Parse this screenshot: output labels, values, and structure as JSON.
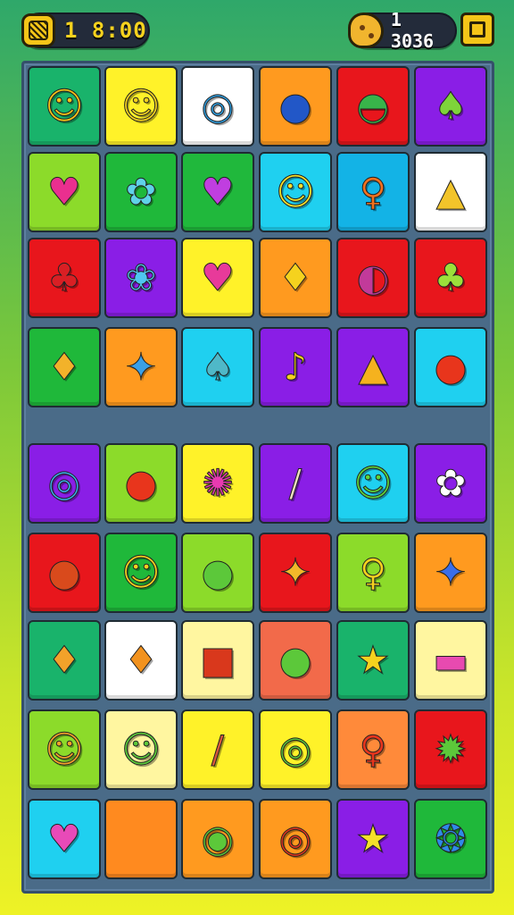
{
  "hud": {
    "coins": "1 8:00",
    "score": "1 3036",
    "coin_icon": "coin-icon",
    "cookie_icon": "cookie-icon",
    "menu_icon": "menu-icon"
  },
  "board": {
    "rows": [
      [
        {
          "name": "lion-face",
          "glyph": "☺",
          "bg": "#19b36b",
          "fg": "#f5c518"
        },
        {
          "name": "sun-face",
          "glyph": "☺",
          "bg": "#fff229",
          "fg": "#f5d21e"
        },
        {
          "name": "swirl-candy",
          "glyph": "◎",
          "bg": "#ffffff",
          "fg": "#2e9ee0"
        },
        {
          "name": "blue-ball",
          "glyph": "●",
          "bg": "#ff9a1f",
          "fg": "#2257c7"
        },
        {
          "name": "watermelon-ball",
          "glyph": "◓",
          "bg": "#e8161c",
          "fg": "#38b54a"
        },
        {
          "name": "green-leaf",
          "glyph": "♠",
          "bg": "#8a1ee6",
          "fg": "#7ed43a"
        }
      ],
      [
        {
          "name": "pink-cat",
          "glyph": "♥",
          "bg": "#8cdb2a",
          "fg": "#ea2f8f"
        },
        {
          "name": "blue-bow",
          "glyph": "✿",
          "bg": "#1fb83a",
          "fg": "#5fd2e8"
        },
        {
          "name": "purple-cat",
          "glyph": "♥",
          "bg": "#20b83c",
          "fg": "#c03ee0"
        },
        {
          "name": "yellow-cat",
          "glyph": "☺",
          "bg": "#1fd0f0",
          "fg": "#f5e12a"
        },
        {
          "name": "orange-lollipop",
          "glyph": "♀",
          "bg": "#13b3e6",
          "fg": "#f2711e"
        },
        {
          "name": "ice-cream-cone",
          "glyph": "▲",
          "bg": "#ffffff",
          "fg": "#f2c42a"
        }
      ],
      [
        {
          "name": "red-bear",
          "glyph": "♣",
          "bg": "#e8161c",
          "fg": "#d91f24"
        },
        {
          "name": "blue-flower",
          "glyph": "❀",
          "bg": "#8a1ee6",
          "fg": "#4fc6f0"
        },
        {
          "name": "pink-cat-head",
          "glyph": "♥",
          "bg": "#fff229",
          "fg": "#e83a9a"
        },
        {
          "name": "pineapple",
          "glyph": "♦",
          "bg": "#ff9a1f",
          "fg": "#f5d21e"
        },
        {
          "name": "striped-candy",
          "glyph": "◐",
          "bg": "#e8161c",
          "fg": "#c23a9a"
        },
        {
          "name": "broccoli-face",
          "glyph": "♣",
          "bg": "#e8161c",
          "fg": "#9be03a"
        }
      ],
      [
        {
          "name": "mango-leaf",
          "glyph": "♦",
          "bg": "#1fb83a",
          "fg": "#f2b22a"
        },
        {
          "name": "blue-star-pin",
          "glyph": "✦",
          "bg": "#ff9a1f",
          "fg": "#3aa0e8"
        },
        {
          "name": "teal-feather",
          "glyph": "♠",
          "bg": "#1fd0f0",
          "fg": "#4fb8c8"
        },
        {
          "name": "yellow-bird",
          "glyph": "♪",
          "bg": "#8a1ee6",
          "fg": "#f5d21e"
        },
        {
          "name": "layer-cake",
          "glyph": "▲",
          "bg": "#8a1ee6",
          "fg": "#f5b21e"
        },
        {
          "name": "red-apple",
          "glyph": "●",
          "bg": "#1fd0f0",
          "fg": "#e8351c"
        }
      ],
      [
        {
          "name": "swirl-lollipop",
          "glyph": "◎",
          "bg": "#8a1ee6",
          "fg": "#3ab0f0"
        },
        {
          "name": "red-blob",
          "glyph": "●",
          "bg": "#8cdb2a",
          "fg": "#e8351c"
        },
        {
          "name": "pink-octopus",
          "glyph": "✺",
          "bg": "#fff229",
          "fg": "#e83ab0"
        },
        {
          "name": "candy-stick",
          "glyph": "/",
          "bg": "#8a1ee6",
          "fg": "#f2e2c2"
        },
        {
          "name": "green-smiley",
          "glyph": "☺",
          "bg": "#1fd0f0",
          "fg": "#5fd43a"
        },
        {
          "name": "white-flower",
          "glyph": "✿",
          "bg": "#8a1ee6",
          "fg": "#ffffff"
        }
      ],
      [
        {
          "name": "onion",
          "glyph": "●",
          "bg": "#e8161c",
          "fg": "#d94a1c"
        },
        {
          "name": "hat-smiley",
          "glyph": "☺",
          "bg": "#1fb83a",
          "fg": "#f5d21e"
        },
        {
          "name": "green-cabbage",
          "glyph": "●",
          "bg": "#8cdb2a",
          "fg": "#5cc83a"
        },
        {
          "name": "origami-leaf",
          "glyph": "✦",
          "bg": "#e8161c",
          "fg": "#f2b82a"
        },
        {
          "name": "yellow-lollipop",
          "glyph": "♀",
          "bg": "#8cdb2a",
          "fg": "#f5d21e"
        },
        {
          "name": "blue-pinwheel",
          "glyph": "✦",
          "bg": "#ff9a1f",
          "fg": "#3a6ee8"
        }
      ],
      [
        {
          "name": "carambola",
          "glyph": "♦",
          "bg": "#19b36b",
          "fg": "#f2a22a"
        },
        {
          "name": "pinecone",
          "glyph": "♦",
          "bg": "#ffffff",
          "fg": "#f2921e"
        },
        {
          "name": "red-jar",
          "glyph": "■",
          "bg": "#fff6a0",
          "fg": "#d9381c"
        },
        {
          "name": "green-apple",
          "glyph": "●",
          "bg": "#f26a4a",
          "fg": "#5cc83a"
        },
        {
          "name": "star-wand",
          "glyph": "★",
          "bg": "#19b36b",
          "fg": "#f5d21e"
        },
        {
          "name": "pink-cupcake",
          "glyph": "▬",
          "bg": "#fff6a0",
          "fg": "#e84ab0"
        }
      ],
      [
        {
          "name": "orange-bear",
          "glyph": "☺",
          "bg": "#8cdb2a",
          "fg": "#f2a22a"
        },
        {
          "name": "green-face",
          "glyph": "☺",
          "bg": "#fff6a0",
          "fg": "#5cc83a"
        },
        {
          "name": "rolling-pin",
          "glyph": "/",
          "bg": "#fff229",
          "fg": "#d95a3a"
        },
        {
          "name": "magnifier-candy",
          "glyph": "◎",
          "bg": "#fff229",
          "fg": "#5cc83a"
        },
        {
          "name": "red-lolly",
          "glyph": "♀",
          "bg": "#ff8a3a",
          "fg": "#e8351c"
        },
        {
          "name": "star-gear",
          "glyph": "✹",
          "bg": "#e8161c",
          "fg": "#5cc83a"
        }
      ],
      [
        {
          "name": "pink-bow-head",
          "glyph": "♥",
          "bg": "#1fd0f0",
          "fg": "#e84ab8"
        },
        {
          "name": "empty-slot",
          "glyph": "",
          "bg": "#ff8a1f",
          "fg": "#ff8a1f"
        },
        {
          "name": "green-donut",
          "glyph": "◉",
          "bg": "#ff9a1f",
          "fg": "#5cc83a"
        },
        {
          "name": "red-magnifier",
          "glyph": "◎",
          "bg": "#ff9a1f",
          "fg": "#e8351c"
        },
        {
          "name": "yellow-star",
          "glyph": "★",
          "bg": "#8a1ee6",
          "fg": "#f5e12a"
        },
        {
          "name": "blue-badge",
          "glyph": "❂",
          "bg": "#1fb83a",
          "fg": "#2f8ae8"
        }
      ]
    ]
  }
}
